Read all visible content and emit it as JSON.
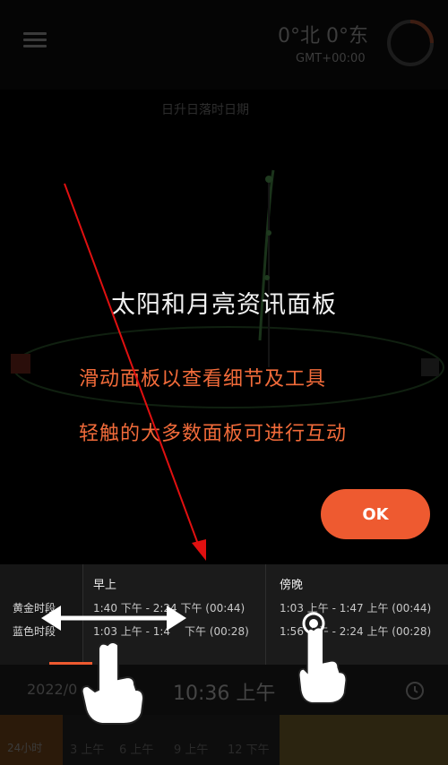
{
  "header": {
    "coords": "0°北 0°东",
    "gmt": "GMT+00:00"
  },
  "sky": {
    "subtitle": "日升日落时日期"
  },
  "overlay": {
    "title": "太阳和月亮资讯面板",
    "line1": "滑动面板以查看细节及工具",
    "line2": "轻触的大多数面板可进行互动",
    "ok_label": "OK"
  },
  "panel": {
    "row_labels": [
      "黄金时段",
      "蓝色时段"
    ],
    "morning": {
      "title": "早上",
      "golden": "1:40 下午 - 2:24 下午 (00:44)",
      "blue": "1:03 上午 - 1:4"
    },
    "evening": {
      "title": "傍晚",
      "golden": "1:03 上午 - 1:47 上午 (00:44)",
      "blue": "1:56 上午 - 2:24 上午 (00:28)"
    },
    "morning_blue_tail": "下午 (00:28)"
  },
  "bottom": {
    "date": "2022/0",
    "time": "10:36 上午"
  },
  "timeline": {
    "label_24": "24小时",
    "ticks": [
      "3 上午",
      "6 上午",
      "9 上午",
      "12 下午"
    ]
  },
  "colors": {
    "accent": "#ee5a30",
    "annotation_red": "#e01010"
  }
}
